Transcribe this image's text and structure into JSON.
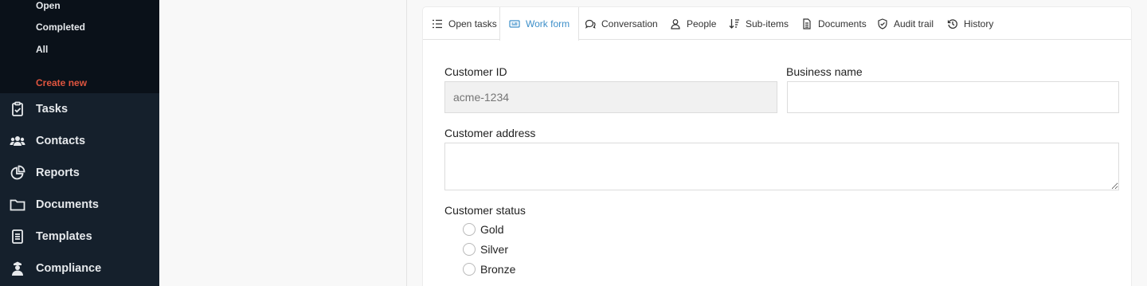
{
  "sidebar": {
    "submenu": {
      "open": "Open",
      "completed": "Completed",
      "all": "All",
      "create_new": "Create new"
    },
    "items": [
      {
        "label": "Tasks",
        "icon": "clipboard-check-icon"
      },
      {
        "label": "Contacts",
        "icon": "users-icon"
      },
      {
        "label": "Reports",
        "icon": "pie-chart-icon"
      },
      {
        "label": "Documents",
        "icon": "folder-icon"
      },
      {
        "label": "Templates",
        "icon": "file-text-icon"
      },
      {
        "label": "Compliance",
        "icon": "user-shield-icon"
      }
    ]
  },
  "tabs": [
    {
      "label": "Open tasks",
      "icon": "list-icon"
    },
    {
      "label": "Work form",
      "icon": "form-icon",
      "active": true
    },
    {
      "label": "Conversation",
      "icon": "chat-icon"
    },
    {
      "label": "People",
      "icon": "person-icon"
    },
    {
      "label": "Sub-items",
      "icon": "sort-icon"
    },
    {
      "label": "Documents",
      "icon": "document-icon"
    },
    {
      "label": "Audit trail",
      "icon": "shield-check-icon"
    },
    {
      "label": "History",
      "icon": "history-icon"
    }
  ],
  "form": {
    "customer_id": {
      "label": "Customer ID",
      "placeholder": "acme-1234"
    },
    "business_name": {
      "label": "Business name",
      "value": ""
    },
    "customer_address": {
      "label": "Customer address",
      "value": ""
    },
    "customer_status": {
      "label": "Customer status",
      "options": [
        "Gold",
        "Silver",
        "Bronze"
      ]
    }
  },
  "colors": {
    "sidebar_bg": "#15202c",
    "submenu_bg": "#0a1119",
    "accent": "#3d8fc9",
    "create_new": "#e0553f"
  }
}
